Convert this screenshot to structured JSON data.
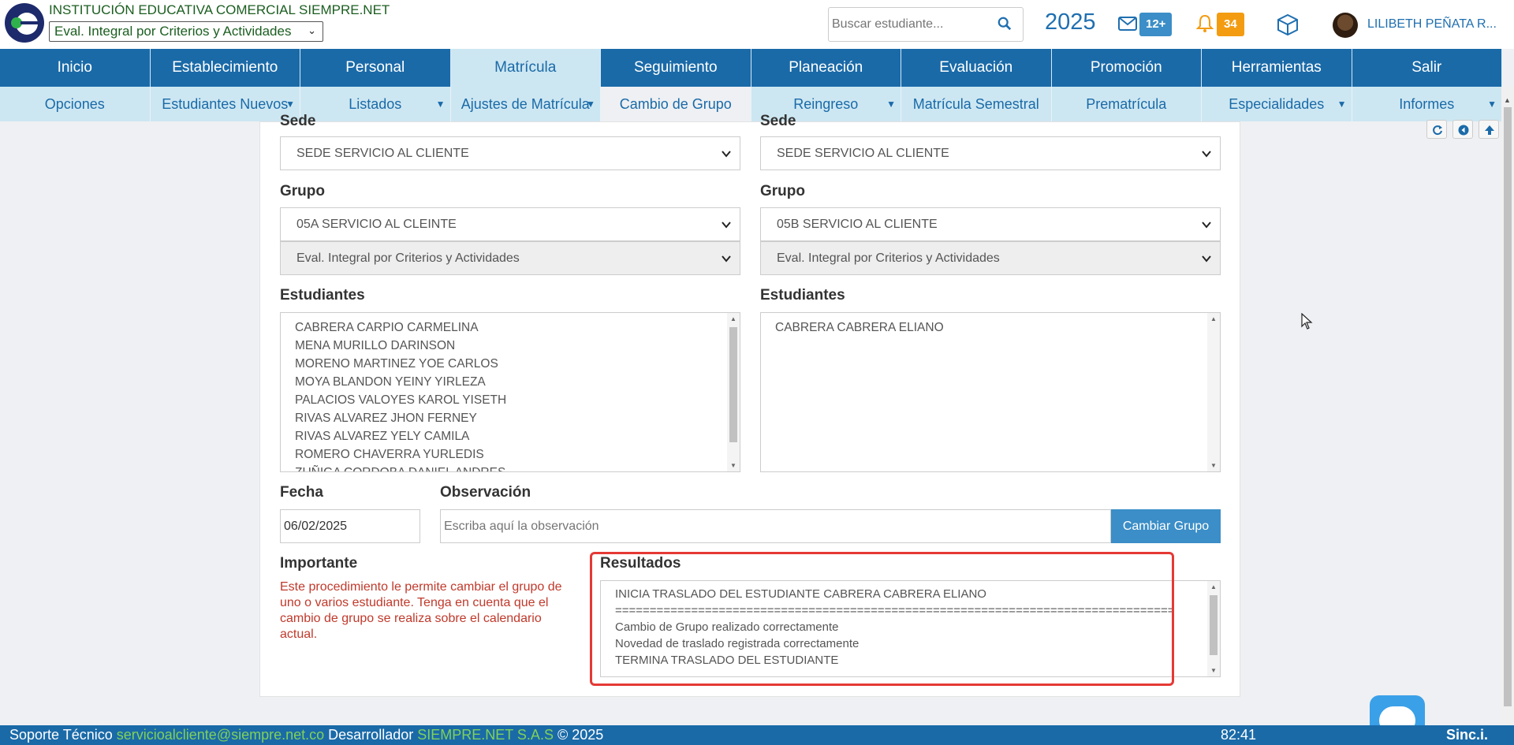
{
  "header": {
    "institution": "INSTITUCIÓN EDUCATIVA COMERCIAL SIEMPRE.NET",
    "eval_select": "Eval. Integral por Criterios y Actividades",
    "search_placeholder": "Buscar estudiante...",
    "year": "2025",
    "messages_badge": "12+",
    "notifications_badge": "34",
    "user_name": "LILIBETH PEÑATA R..."
  },
  "nav_main": [
    "Inicio",
    "Establecimiento",
    "Personal",
    "Matrícula",
    "Seguimiento",
    "Planeación",
    "Evaluación",
    "Promoción",
    "Herramientas",
    "Salir"
  ],
  "nav_sub": [
    {
      "label": "Opciones",
      "caret": ""
    },
    {
      "label": "Estudiantes Nuevos",
      "caret": "▼"
    },
    {
      "label": "Listados",
      "caret": "▼"
    },
    {
      "label": "Ajustes de Matrícula",
      "caret": "▼"
    },
    {
      "label": "Cambio de Grupo",
      "caret": ""
    },
    {
      "label": "Reingreso",
      "caret": "▼"
    },
    {
      "label": "Matrícula Semestral",
      "caret": ""
    },
    {
      "label": "Prematrícula",
      "caret": ""
    },
    {
      "label": "Especialidades",
      "caret": "▼"
    },
    {
      "label": "Informes",
      "caret": "▼"
    }
  ],
  "origin": {
    "sede_label": "Sede",
    "sede_value": "SEDE SERVICIO AL CLIENTE",
    "grupo_label": "Grupo",
    "grupo_value": "05A SERVICIO AL CLEINTE",
    "eval_value": "Eval. Integral por Criterios y Actividades",
    "students_label": "Estudiantes",
    "students": [
      "CABRERA CARPIO CARMELINA",
      "MENA MURILLO DARINSON",
      "MORENO MARTINEZ YOE CARLOS",
      "MOYA BLANDON YEINY YIRLEZA",
      "PALACIOS VALOYES KAROL YISETH",
      "RIVAS ALVAREZ JHON FERNEY",
      "RIVAS ALVAREZ YELY CAMILA",
      "ROMERO CHAVERRA YURLEDIS",
      "ZUÑIGA CORDOBA DANIEL ANDRES"
    ]
  },
  "destination": {
    "sede_label": "Sede",
    "sede_value": "SEDE SERVICIO AL CLIENTE",
    "grupo_label": "Grupo",
    "grupo_value": "05B SERVICIO AL CLIENTE",
    "eval_value": "Eval. Integral por Criterios y Actividades",
    "students_label": "Estudiantes",
    "students": [
      "CABRERA CABRERA ELIANO"
    ]
  },
  "form": {
    "fecha_label": "Fecha",
    "fecha_value": "06/02/2025",
    "observacion_label": "Observación",
    "observacion_placeholder": "Escriba aquí la observación",
    "submit_label": "Cambiar Grupo"
  },
  "importante": {
    "label": "Importante",
    "text": "Este procedimiento le permite cambiar el grupo de uno o varios estudiante. Tenga en cuenta que el cambio de grupo se realiza sobre el calendario actual."
  },
  "resultados": {
    "label": "Resultados",
    "lines": [
      "INICIA TRASLADO DEL ESTUDIANTE CABRERA CABRERA ELIANO",
      "=================================================================================",
      "Cambio de Grupo realizado correctamente",
      "Novedad de traslado registrada correctamente",
      "TERMINA TRASLADO DEL ESTUDIANTE"
    ]
  },
  "footer": {
    "support_label": "Soporte Técnico",
    "support_email": "servicioalcliente@siempre.net.co",
    "dev_label": "Desarrollador",
    "dev_name": "SIEMPRE.NET S.A.S",
    "copyright": "© 2025",
    "timer": "82:41",
    "brand": "Sinc.i."
  },
  "colors": {
    "primary": "#1a6aa8",
    "nav_light": "#cde7f2",
    "badge_orange": "#f39c12",
    "highlight_red": "#e53935",
    "warning_text": "#c0392b"
  }
}
